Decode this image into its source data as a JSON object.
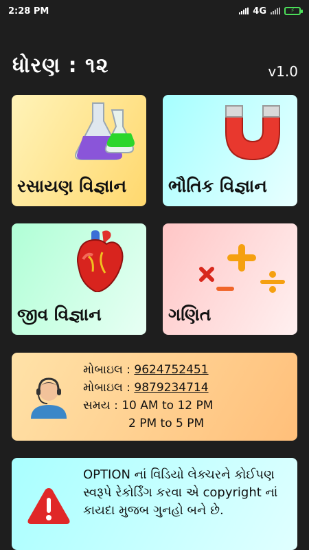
{
  "status_bar": {
    "time": "2:28 PM",
    "network": "4G",
    "icons": [
      "signal-icon",
      "wifi-signal-icon",
      "battery-charging-icon"
    ]
  },
  "header": {
    "title": "ધોરણ : ૧૨",
    "version": "v1.0"
  },
  "subjects": [
    {
      "label": "રસાયણ વિજ્ઞાન",
      "icon": "flasks-icon",
      "gradient": [
        "#fff3b8",
        "#ffd86e"
      ]
    },
    {
      "label": "ભૌતિક વિજ્ઞાન",
      "icon": "magnet-icon",
      "gradient": [
        "#a6ffff",
        "#e9ffff"
      ]
    },
    {
      "label": "જીવ વિજ્ઞાન",
      "icon": "heart-icon",
      "gradient": [
        "#b0ffd6",
        "#e8fff4"
      ]
    },
    {
      "label": "ગણિત",
      "icon": "math-operators-icon",
      "gradient": [
        "#ffc6c6",
        "#fff0f0"
      ]
    }
  ],
  "contact": {
    "icon": "support-agent-icon",
    "mobile_label": "મોબાઇલ :",
    "mobile1": "9624752451",
    "mobile2": "9879234714",
    "time_label": "સમય :",
    "time1": "10 AM to 12 PM",
    "time2": "2 PM to 5 PM"
  },
  "notice": {
    "icon": "warning-icon",
    "text": "OPTION નાં વિડિયો લેક્ચરને કોઈપણ સ્વરૂપે રેકોર્ડિંગ કરવા એ copyright નાં કાયદા મુજબ ગુનહો બને છે."
  },
  "colors": {
    "background": "#1e1e1e",
    "battery": "#4cdf5a",
    "warning": "#e02828"
  }
}
